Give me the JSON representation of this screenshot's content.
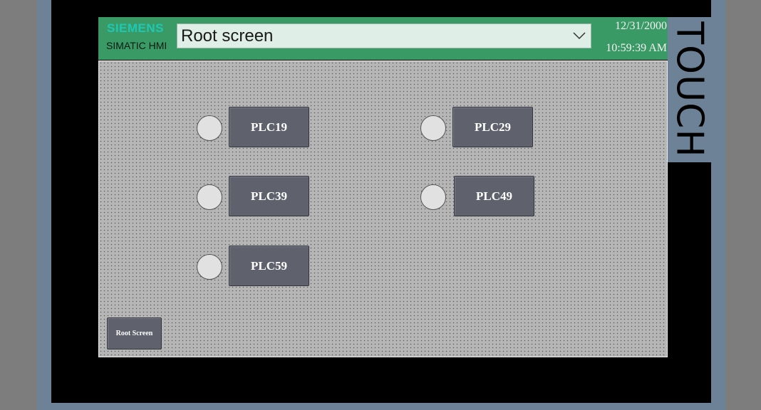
{
  "brand": {
    "company": "SIEMENS",
    "product": "SIMATIC HMI"
  },
  "screen_selector": {
    "value": "Root screen",
    "icon": "chevron-down-icon"
  },
  "clock": {
    "date": "12/31/2000",
    "time": "10:59:39 AM"
  },
  "device": {
    "label": "TOUCH"
  },
  "plc_buttons": [
    {
      "label": "PLC19"
    },
    {
      "label": "PLC29"
    },
    {
      "label": "PLC39"
    },
    {
      "label": "PLC49"
    },
    {
      "label": "PLC59"
    }
  ],
  "nav": {
    "root_screen_label": "Root Screen"
  },
  "colors": {
    "header_bg": "#3a9a66",
    "brand_accent": "#1ec8b4",
    "button_bg": "#5f616c",
    "frame": "#6d8296",
    "lamp_off": "#e1e1e1"
  }
}
